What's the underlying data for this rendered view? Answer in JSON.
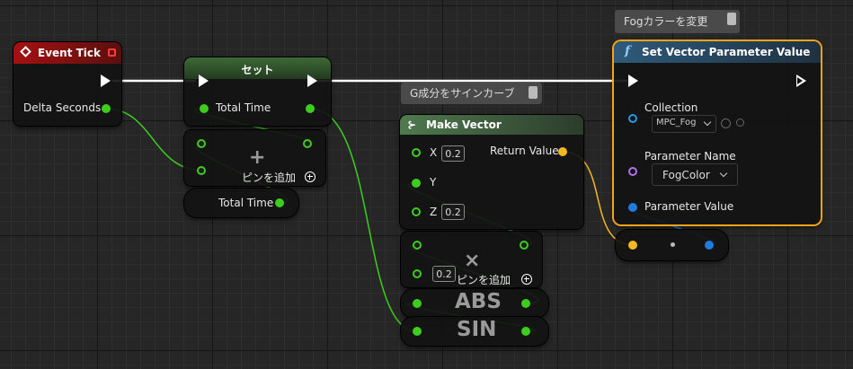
{
  "comments": {
    "fog_color": "Fogカラーを変更",
    "g_component": "G成分をサインカーブ"
  },
  "event_tick": {
    "title": "Event Tick",
    "pin_delta": "Delta Seconds"
  },
  "set_node": {
    "title": "セット",
    "pin_total": "Total Time"
  },
  "add_node": {
    "op": "+",
    "add_pin": "ピンを追加"
  },
  "get_total": {
    "label": "Total Time"
  },
  "make_vector": {
    "title": "Make Vector",
    "pin_x": "X",
    "x_value": "0.2",
    "pin_y": "Y",
    "pin_z": "Z",
    "z_value": "0.2",
    "return": "Return Value"
  },
  "multiply_node": {
    "op": "×",
    "value": "0.2",
    "add_pin": "ピンを追加"
  },
  "abs_node": {
    "op": "ABS"
  },
  "sin_node": {
    "op": "SIN"
  },
  "set_vector_param": {
    "title": "Set Vector Parameter Value",
    "func_icon": "f",
    "collection_label": "Collection",
    "collection_value": "MPC_Fog",
    "param_name_label": "Parameter Name",
    "param_name_value": "FogColor",
    "param_value_label": "Parameter Value"
  },
  "colors": {
    "exec": "#ffffff",
    "float_pin": "#3ccd1f",
    "vector_pin": "#f6b81d",
    "linear_color_pin": "#1f7bde",
    "object_pin": "#1f9be0",
    "name_pin": "#b071ec",
    "selected_outline": "#f5a319"
  }
}
